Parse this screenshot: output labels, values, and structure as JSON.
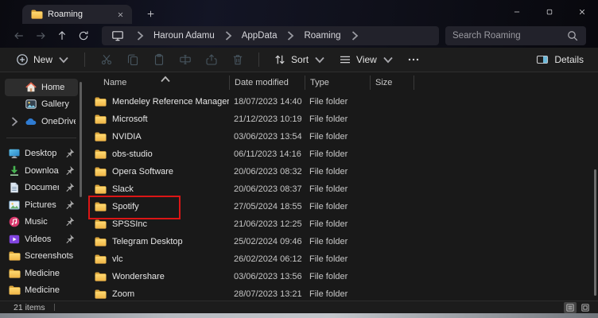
{
  "colors": {
    "annotation_red": "#db1515",
    "folder_back": "#dda73c",
    "folder_front": "#f8cf5e",
    "details_accent": "#6cb8d8"
  },
  "titlebar": {
    "tab": {
      "title": "Roaming"
    }
  },
  "addressbar": {
    "breadcrumbs": [
      "Haroun Adamu",
      "AppData",
      "Roaming"
    ],
    "search": {
      "placeholder": "Search Roaming",
      "value": ""
    }
  },
  "toolbar": {
    "new_label": "New",
    "sort_label": "Sort",
    "view_label": "View",
    "details_label": "Details",
    "disabled_actions": [
      "cut",
      "copy",
      "paste",
      "rename",
      "share",
      "delete"
    ]
  },
  "sidebar": {
    "items": [
      {
        "label": "Home",
        "icon": "home",
        "section": "top",
        "selected": true
      },
      {
        "label": "Gallery",
        "icon": "gallery",
        "section": "top"
      },
      {
        "label": "OneDrive - Perso",
        "icon": "onedrive",
        "section": "top",
        "expandable": true
      },
      {
        "divider": true
      },
      {
        "label": "Desktop",
        "icon": "desktop",
        "pinned": true
      },
      {
        "label": "Downloads",
        "icon": "downloads",
        "pinned": true
      },
      {
        "label": "Documents",
        "icon": "documents",
        "pinned": true
      },
      {
        "label": "Pictures",
        "icon": "pictures",
        "pinned": true
      },
      {
        "label": "Music",
        "icon": "music",
        "pinned": true
      },
      {
        "label": "Videos",
        "icon": "videos",
        "pinned": true
      },
      {
        "label": "Screenshots",
        "icon": "folder"
      },
      {
        "label": "Medicine",
        "icon": "folder"
      },
      {
        "label": "Medicine",
        "icon": "folder"
      }
    ]
  },
  "filelist": {
    "columns": [
      "Name",
      "Date modified",
      "Type",
      "Size"
    ],
    "sort_column": "Name",
    "rows": [
      {
        "name": "Mendeley Reference Manager",
        "date_modified": "18/07/2023 14:40",
        "type": "File folder",
        "size": ""
      },
      {
        "name": "Microsoft",
        "date_modified": "21/12/2023 10:19",
        "type": "File folder",
        "size": ""
      },
      {
        "name": "NVIDIA",
        "date_modified": "03/06/2023 13:54",
        "type": "File folder",
        "size": ""
      },
      {
        "name": "obs-studio",
        "date_modified": "06/11/2023 14:16",
        "type": "File folder",
        "size": ""
      },
      {
        "name": "Opera Software",
        "date_modified": "20/06/2023 08:32",
        "type": "File folder",
        "size": ""
      },
      {
        "name": "Slack",
        "date_modified": "20/06/2023 08:37",
        "type": "File folder",
        "size": ""
      },
      {
        "name": "Spotify",
        "date_modified": "27/05/2024 18:55",
        "type": "File folder",
        "size": "",
        "annotated": true
      },
      {
        "name": "SPSSInc",
        "date_modified": "21/06/2023 12:25",
        "type": "File folder",
        "size": ""
      },
      {
        "name": "Telegram Desktop",
        "date_modified": "25/02/2024 09:46",
        "type": "File folder",
        "size": ""
      },
      {
        "name": "vlc",
        "date_modified": "26/02/2024 06:12",
        "type": "File folder",
        "size": ""
      },
      {
        "name": "Wondershare",
        "date_modified": "03/06/2023 13:56",
        "type": "File folder",
        "size": ""
      },
      {
        "name": "Zoom",
        "date_modified": "28/07/2023 13:21",
        "type": "File folder",
        "size": ""
      }
    ]
  },
  "statusbar": {
    "items_count": "21 items"
  }
}
